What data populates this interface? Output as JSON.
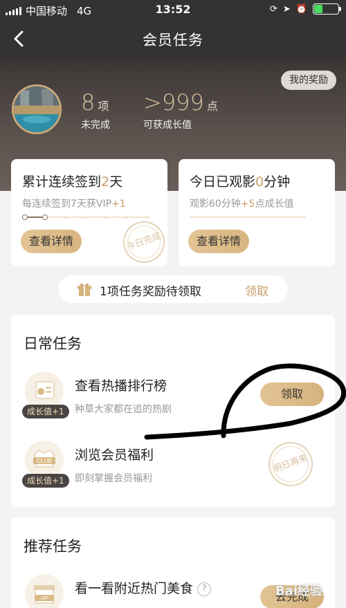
{
  "status_bar": {
    "carrier": "中国移动",
    "network": "4G",
    "time": "13:52",
    "battery_level": 0.35,
    "battery_color": "#4cd964"
  },
  "nav": {
    "back_icon": "chevron-left-icon",
    "title": "会员任务"
  },
  "header": {
    "reward_button": "我的奖励",
    "incomplete_count": "8",
    "incomplete_unit": "项",
    "incomplete_label": "未完成",
    "growth_value": ">999",
    "growth_unit": "点",
    "growth_label": "可获成长值"
  },
  "checkin_card": {
    "title_prefix": "累计连续签到",
    "days": "2",
    "title_suffix": "天",
    "sub_prefix": "每连续签到7天获VIP",
    "sub_bonus": "+1",
    "progress_done": 2,
    "progress_total": 7,
    "button": "查看详情",
    "stamp": "今日完成"
  },
  "watch_card": {
    "title_prefix": "今日已观影",
    "minutes": "0",
    "title_suffix": "分钟",
    "sub_prefix": "观影60分钟",
    "sub_bonus": "+5",
    "sub_suffix": "点成长值",
    "progress": 0,
    "button": "查看详情"
  },
  "pending": {
    "icon": "gift-box-icon",
    "text": "1项任务奖励待领取",
    "claim": "领取"
  },
  "daily": {
    "title": "日常任务",
    "tasks": [
      {
        "name": "查看热播排行榜",
        "desc": "种草大家都在追的热剧",
        "badge": "成长值+1",
        "action": "领取",
        "icon": "ranking-list-icon"
      },
      {
        "name": "浏览会员福利",
        "desc": "即刻掌握会员福利",
        "badge": "成长值+1",
        "stamp": "明日再来",
        "icon": "club-badge-icon"
      }
    ]
  },
  "recommend": {
    "title": "推荐任务",
    "tasks": [
      {
        "name": "看一看附近热门美食",
        "action": "去完成",
        "icon": "vip-gift-icon",
        "help_icon": "question-mark-icon",
        "help_glyph": "?"
      }
    ]
  },
  "colors": {
    "accent_gold": "#c9a06a",
    "button_gold": "#e2c494",
    "dark_header": "#333333"
  },
  "watermark": "Bai经验"
}
